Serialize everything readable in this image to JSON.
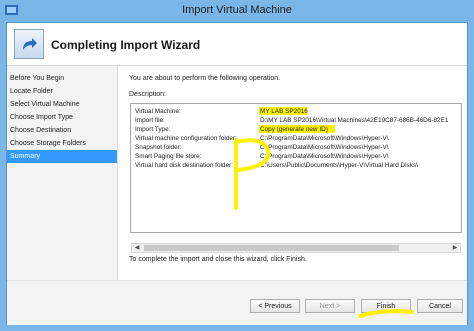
{
  "window": {
    "title": "Import Virtual Machine"
  },
  "header": {
    "title": "Completing Import Wizard",
    "icon": "wizard-arrow-icon"
  },
  "sidebar": {
    "items": [
      {
        "label": "Before You Begin",
        "active": false
      },
      {
        "label": "Locate Folder",
        "active": false
      },
      {
        "label": "Select Virtual Machine",
        "active": false
      },
      {
        "label": "Choose Import Type",
        "active": false
      },
      {
        "label": "Choose Destination",
        "active": false
      },
      {
        "label": "Choose Storage Folders",
        "active": false
      },
      {
        "label": "Summary",
        "active": true
      }
    ]
  },
  "main": {
    "intro": "You are about to perform the following operation.",
    "description_label": "Description:",
    "rows": [
      {
        "key": "Virtual Machine:",
        "value": "MY LAB SP2016"
      },
      {
        "key": "Import file:",
        "value": "D:\\MY LAB SP2016\\Virtual Machines\\42E19C87-686B-46D6-82E1"
      },
      {
        "key": "Import Type:",
        "value": "Copy (generate new ID)"
      },
      {
        "key": "Virtual machine configuration folder:",
        "value": "C:\\ProgramData\\Microsoft\\Windows\\Hyper-V\\"
      },
      {
        "key": "Snapshot folder:",
        "value": "C:\\ProgramData\\Microsoft\\Windows\\Hyper-V\\"
      },
      {
        "key": "Smart Paging file store:",
        "value": "C:\\ProgramData\\Microsoft\\Windows\\Hyper-V\\"
      },
      {
        "key": "Virtual hard disk destination folder:",
        "value": "C:\\Users\\Public\\Documents\\Hyper-V\\Virtual Hard Disks\\"
      }
    ],
    "finish_note": "To complete the import and close this wizard, click Finish."
  },
  "footer": {
    "previous": "< Previous",
    "next": "Next >",
    "finish": "Finish",
    "cancel": "Cancel"
  },
  "colors": {
    "title_bar": "#7ab7e8",
    "selection": "#3399ff",
    "highlight": "#fff200"
  }
}
